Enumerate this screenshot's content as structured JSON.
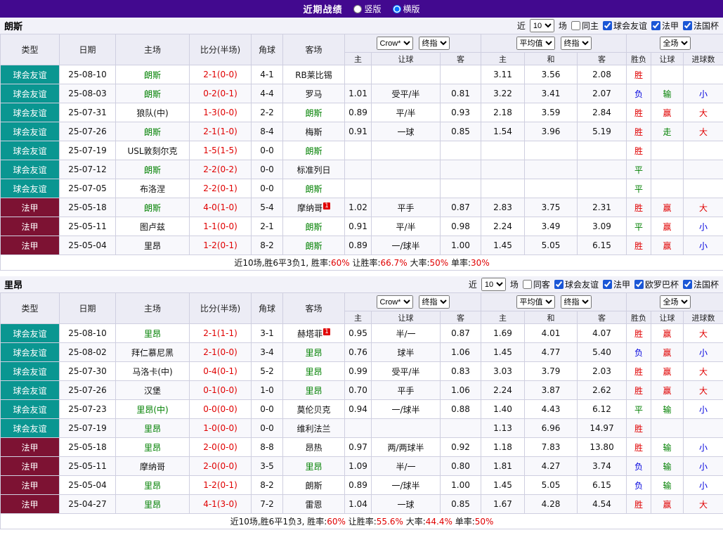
{
  "header": {
    "title": "近期战绩",
    "options": [
      {
        "label": "竖版",
        "selected": false
      },
      {
        "label": "横版",
        "selected": true
      }
    ]
  },
  "colors": {
    "topbar_bg": "#42098f",
    "type_badges": {
      "球会友谊": "#0a9691",
      "法甲": "#7d1233"
    },
    "focus_team": "#008000",
    "score": "#e00000",
    "stat_value": "#e00000",
    "sup_badge": "#e00000",
    "result_map": {
      "胜": "#e00000",
      "平": "#008000",
      "负": "#0000dd",
      "赢": "#e00000",
      "输": "#008000",
      "走": "#008000",
      "大": "#e00000",
      "小": "#0000dd"
    }
  },
  "table_header": {
    "main_cols": [
      "类型",
      "日期",
      "主场",
      "比分(半场)",
      "角球",
      "客场"
    ],
    "odds_group": {
      "selects": [
        "Crow*",
        "终指"
      ],
      "cols": [
        "主",
        "让球",
        "客"
      ]
    },
    "avg_group": {
      "selects": [
        "平均值",
        "终指"
      ],
      "cols": [
        "主",
        "和",
        "客"
      ]
    },
    "result_group": {
      "selects": [
        "全场"
      ],
      "cols": [
        "胜负",
        "让球",
        "进球数"
      ]
    }
  },
  "sections": [
    {
      "team": "朗斯",
      "filter": {
        "prefix": "近",
        "count": "10",
        "suffix": "场",
        "checks": [
          {
            "label": "同主",
            "checked": false
          },
          {
            "label": "球会友谊",
            "checked": true
          },
          {
            "label": "法甲",
            "checked": true
          },
          {
            "label": "法国杯",
            "checked": true
          }
        ]
      },
      "rows": [
        {
          "type": "球会友谊",
          "date": "25-08-10",
          "home": "朗斯",
          "home_sup": "",
          "score": "2-1(0-0)",
          "corner": "4-1",
          "away": "RB莱比锡",
          "away_sup": "",
          "odds": [
            "",
            "",
            ""
          ],
          "avg": [
            "3.11",
            "3.56",
            "2.08"
          ],
          "res": [
            "胜",
            "",
            ""
          ]
        },
        {
          "type": "球会友谊",
          "date": "25-08-03",
          "home": "朗斯",
          "home_sup": "",
          "score": "0-2(0-1)",
          "corner": "4-4",
          "away": "罗马",
          "away_sup": "",
          "odds": [
            "1.01",
            "受平/半",
            "0.81"
          ],
          "avg": [
            "3.22",
            "3.41",
            "2.07"
          ],
          "res": [
            "负",
            "输",
            "小"
          ]
        },
        {
          "type": "球会友谊",
          "date": "25-07-31",
          "home": "狼队(中)",
          "home_sup": "",
          "score": "1-3(0-0)",
          "corner": "2-2",
          "away": "朗斯",
          "away_sup": "",
          "odds": [
            "0.89",
            "平/半",
            "0.93"
          ],
          "avg": [
            "2.18",
            "3.59",
            "2.84"
          ],
          "res": [
            "胜",
            "赢",
            "大"
          ]
        },
        {
          "type": "球会友谊",
          "date": "25-07-26",
          "home": "朗斯",
          "home_sup": "",
          "score": "2-1(1-0)",
          "corner": "8-4",
          "away": "梅斯",
          "away_sup": "",
          "odds": [
            "0.91",
            "一球",
            "0.85"
          ],
          "avg": [
            "1.54",
            "3.96",
            "5.19"
          ],
          "res": [
            "胜",
            "走",
            "大"
          ]
        },
        {
          "type": "球会友谊",
          "date": "25-07-19",
          "home": "USL敦刻尔克",
          "home_sup": "",
          "score": "1-5(1-5)",
          "corner": "0-0",
          "away": "朗斯",
          "away_sup": "",
          "odds": [
            "",
            "",
            ""
          ],
          "avg": [
            "",
            "",
            ""
          ],
          "res": [
            "胜",
            "",
            ""
          ]
        },
        {
          "type": "球会友谊",
          "date": "25-07-12",
          "home": "朗斯",
          "home_sup": "",
          "score": "2-2(0-2)",
          "corner": "0-0",
          "away": "标准列日",
          "away_sup": "",
          "odds": [
            "",
            "",
            ""
          ],
          "avg": [
            "",
            "",
            ""
          ],
          "res": [
            "平",
            "",
            ""
          ]
        },
        {
          "type": "球会友谊",
          "date": "25-07-05",
          "home": "布洛涅",
          "home_sup": "",
          "score": "2-2(0-1)",
          "corner": "0-0",
          "away": "朗斯",
          "away_sup": "",
          "odds": [
            "",
            "",
            ""
          ],
          "avg": [
            "",
            "",
            ""
          ],
          "res": [
            "平",
            "",
            ""
          ]
        },
        {
          "type": "法甲",
          "date": "25-05-18",
          "home": "朗斯",
          "home_sup": "",
          "score": "4-0(1-0)",
          "corner": "5-4",
          "away": "摩纳哥",
          "away_sup": "1",
          "odds": [
            "1.02",
            "平手",
            "0.87"
          ],
          "avg": [
            "2.83",
            "3.75",
            "2.31"
          ],
          "res": [
            "胜",
            "赢",
            "大"
          ]
        },
        {
          "type": "法甲",
          "date": "25-05-11",
          "home": "图卢兹",
          "home_sup": "",
          "score": "1-1(0-0)",
          "corner": "2-1",
          "away": "朗斯",
          "away_sup": "",
          "odds": [
            "0.91",
            "平/半",
            "0.98"
          ],
          "avg": [
            "2.24",
            "3.49",
            "3.09"
          ],
          "res": [
            "平",
            "赢",
            "小"
          ]
        },
        {
          "type": "法甲",
          "date": "25-05-04",
          "home": "里昂",
          "home_sup": "",
          "score": "1-2(0-1)",
          "corner": "8-2",
          "away": "朗斯",
          "away_sup": "",
          "odds": [
            "0.89",
            "一/球半",
            "1.00"
          ],
          "avg": [
            "1.45",
            "5.05",
            "6.15"
          ],
          "res": [
            "胜",
            "赢",
            "小"
          ]
        }
      ],
      "summary": {
        "prefix": "近10场,胜6平3负1,",
        "stats": [
          {
            "label": "胜率:",
            "value": "60%"
          },
          {
            "label": "让胜率:",
            "value": "66.7%"
          },
          {
            "label": "大率:",
            "value": "50%"
          },
          {
            "label": "单率:",
            "value": "30%"
          }
        ]
      }
    },
    {
      "team": "里昂",
      "filter": {
        "prefix": "近",
        "count": "10",
        "suffix": "场",
        "checks": [
          {
            "label": "同客",
            "checked": false
          },
          {
            "label": "球会友谊",
            "checked": true
          },
          {
            "label": "法甲",
            "checked": true
          },
          {
            "label": "欧罗巴杯",
            "checked": true
          },
          {
            "label": "法国杯",
            "checked": true
          }
        ]
      },
      "rows": [
        {
          "type": "球会友谊",
          "date": "25-08-10",
          "home": "里昂",
          "home_sup": "",
          "score": "2-1(1-1)",
          "corner": "3-1",
          "away": "赫塔菲",
          "away_sup": "1",
          "odds": [
            "0.95",
            "半/一",
            "0.87"
          ],
          "avg": [
            "1.69",
            "4.01",
            "4.07"
          ],
          "res": [
            "胜",
            "赢",
            "大"
          ]
        },
        {
          "type": "球会友谊",
          "date": "25-08-02",
          "home": "拜仁慕尼黑",
          "home_sup": "",
          "score": "2-1(0-0)",
          "corner": "3-4",
          "away": "里昂",
          "away_sup": "",
          "odds": [
            "0.76",
            "球半",
            "1.06"
          ],
          "avg": [
            "1.45",
            "4.77",
            "5.40"
          ],
          "res": [
            "负",
            "赢",
            "小"
          ]
        },
        {
          "type": "球会友谊",
          "date": "25-07-30",
          "home": "马洛卡(中)",
          "home_sup": "",
          "score": "0-4(0-1)",
          "corner": "5-2",
          "away": "里昂",
          "away_sup": "",
          "odds": [
            "0.99",
            "受平/半",
            "0.83"
          ],
          "avg": [
            "3.03",
            "3.79",
            "2.03"
          ],
          "res": [
            "胜",
            "赢",
            "大"
          ]
        },
        {
          "type": "球会友谊",
          "date": "25-07-26",
          "home": "汉堡",
          "home_sup": "",
          "score": "0-1(0-0)",
          "corner": "1-0",
          "away": "里昂",
          "away_sup": "",
          "odds": [
            "0.70",
            "平手",
            "1.06"
          ],
          "avg": [
            "2.24",
            "3.87",
            "2.62"
          ],
          "res": [
            "胜",
            "赢",
            "大"
          ]
        },
        {
          "type": "球会友谊",
          "date": "25-07-23",
          "home": "里昂(中)",
          "home_sup": "",
          "score": "0-0(0-0)",
          "corner": "0-0",
          "away": "莫伦贝克",
          "away_sup": "",
          "odds": [
            "0.94",
            "一/球半",
            "0.88"
          ],
          "avg": [
            "1.40",
            "4.43",
            "6.12"
          ],
          "res": [
            "平",
            "输",
            "小"
          ]
        },
        {
          "type": "球会友谊",
          "date": "25-07-19",
          "home": "里昂",
          "home_sup": "",
          "score": "1-0(0-0)",
          "corner": "0-0",
          "away": "维利法兰",
          "away_sup": "",
          "odds": [
            "",
            "",
            ""
          ],
          "avg": [
            "1.13",
            "6.96",
            "14.97"
          ],
          "res": [
            "胜",
            "",
            ""
          ]
        },
        {
          "type": "法甲",
          "date": "25-05-18",
          "home": "里昂",
          "home_sup": "",
          "score": "2-0(0-0)",
          "corner": "8-8",
          "away": "昂热",
          "away_sup": "",
          "odds": [
            "0.97",
            "两/两球半",
            "0.92"
          ],
          "avg": [
            "1.18",
            "7.83",
            "13.80"
          ],
          "res": [
            "胜",
            "输",
            "小"
          ]
        },
        {
          "type": "法甲",
          "date": "25-05-11",
          "home": "摩纳哥",
          "home_sup": "",
          "score": "2-0(0-0)",
          "corner": "3-5",
          "away": "里昂",
          "away_sup": "",
          "odds": [
            "1.09",
            "半/一",
            "0.80"
          ],
          "avg": [
            "1.81",
            "4.27",
            "3.74"
          ],
          "res": [
            "负",
            "输",
            "小"
          ]
        },
        {
          "type": "法甲",
          "date": "25-05-04",
          "home": "里昂",
          "home_sup": "",
          "score": "1-2(0-1)",
          "corner": "8-2",
          "away": "朗斯",
          "away_sup": "",
          "odds": [
            "0.89",
            "一/球半",
            "1.00"
          ],
          "avg": [
            "1.45",
            "5.05",
            "6.15"
          ],
          "res": [
            "负",
            "输",
            "小"
          ]
        },
        {
          "type": "法甲",
          "date": "25-04-27",
          "home": "里昂",
          "home_sup": "",
          "score": "4-1(3-0)",
          "corner": "7-2",
          "away": "雷恩",
          "away_sup": "",
          "odds": [
            "1.04",
            "一球",
            "0.85"
          ],
          "avg": [
            "1.67",
            "4.28",
            "4.54"
          ],
          "res": [
            "胜",
            "赢",
            "大"
          ]
        }
      ],
      "summary": {
        "prefix": "近10场,胜6平1负3,",
        "stats": [
          {
            "label": "胜率:",
            "value": "60%"
          },
          {
            "label": "让胜率:",
            "value": "55.6%"
          },
          {
            "label": "大率:",
            "value": "44.4%"
          },
          {
            "label": "单率:",
            "value": "50%"
          }
        ]
      }
    }
  ]
}
